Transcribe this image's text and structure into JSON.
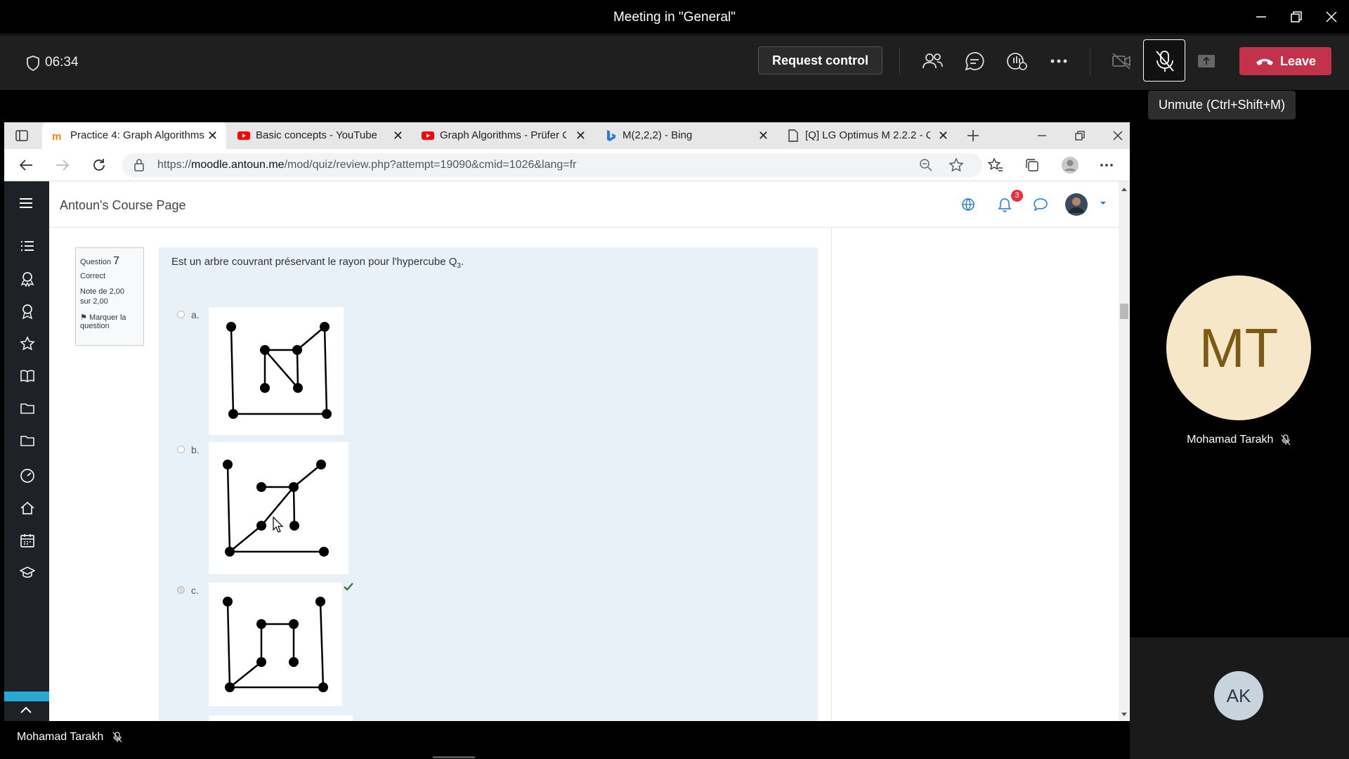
{
  "teams": {
    "window_title": "Meeting in \"General\"",
    "timer": "06:34",
    "request_control": "Request control",
    "leave": "Leave",
    "tooltip": "Unmute (Ctrl+Shift+M)",
    "participant_main": "Mohamad Tarakh",
    "avatar_initials": "MT",
    "participant_small": "AK",
    "sharer_name": "Mohamad Tarakh",
    "colors": {
      "leave": "#c4314b",
      "avatar_bg": "#f5e7c8",
      "avatar_text": "#7a5a17"
    }
  },
  "browser": {
    "tabs": [
      {
        "label": "Practice 4: Graph Algorithms",
        "icon": "moodle-icon",
        "active": true
      },
      {
        "label": "Basic concepts - YouTube",
        "icon": "youtube-icon"
      },
      {
        "label": "Graph Algorithms - Prüfer Co",
        "icon": "youtube-icon"
      },
      {
        "label": "M(2,2,2) - Bing",
        "icon": "bing-icon"
      },
      {
        "label": "[Q] LG Optimus M 2.2.2 - Qu",
        "icon": "document-icon"
      }
    ],
    "url_prefix": "https://",
    "url_host": "moodle.antoun.me",
    "url_path": "/mod/quiz/review.php?attempt=19090&cmid=1026&lang=fr"
  },
  "moodle": {
    "site_title": "Antoun's Course Page",
    "notification_count": "3",
    "question": {
      "label": "Question",
      "number": "7",
      "state": "Correct",
      "grade_line1": "Note de 2,00",
      "grade_line2": "sur 2,00",
      "flag": "Marquer la question",
      "text": "Est un arbre couvrant préservant le rayon pour l'hypercube Q",
      "text_sub": "3",
      "text_end": ".",
      "options": [
        {
          "letter": "a."
        },
        {
          "letter": "b."
        },
        {
          "letter": "c.",
          "selected": true,
          "correct": true
        }
      ]
    }
  }
}
